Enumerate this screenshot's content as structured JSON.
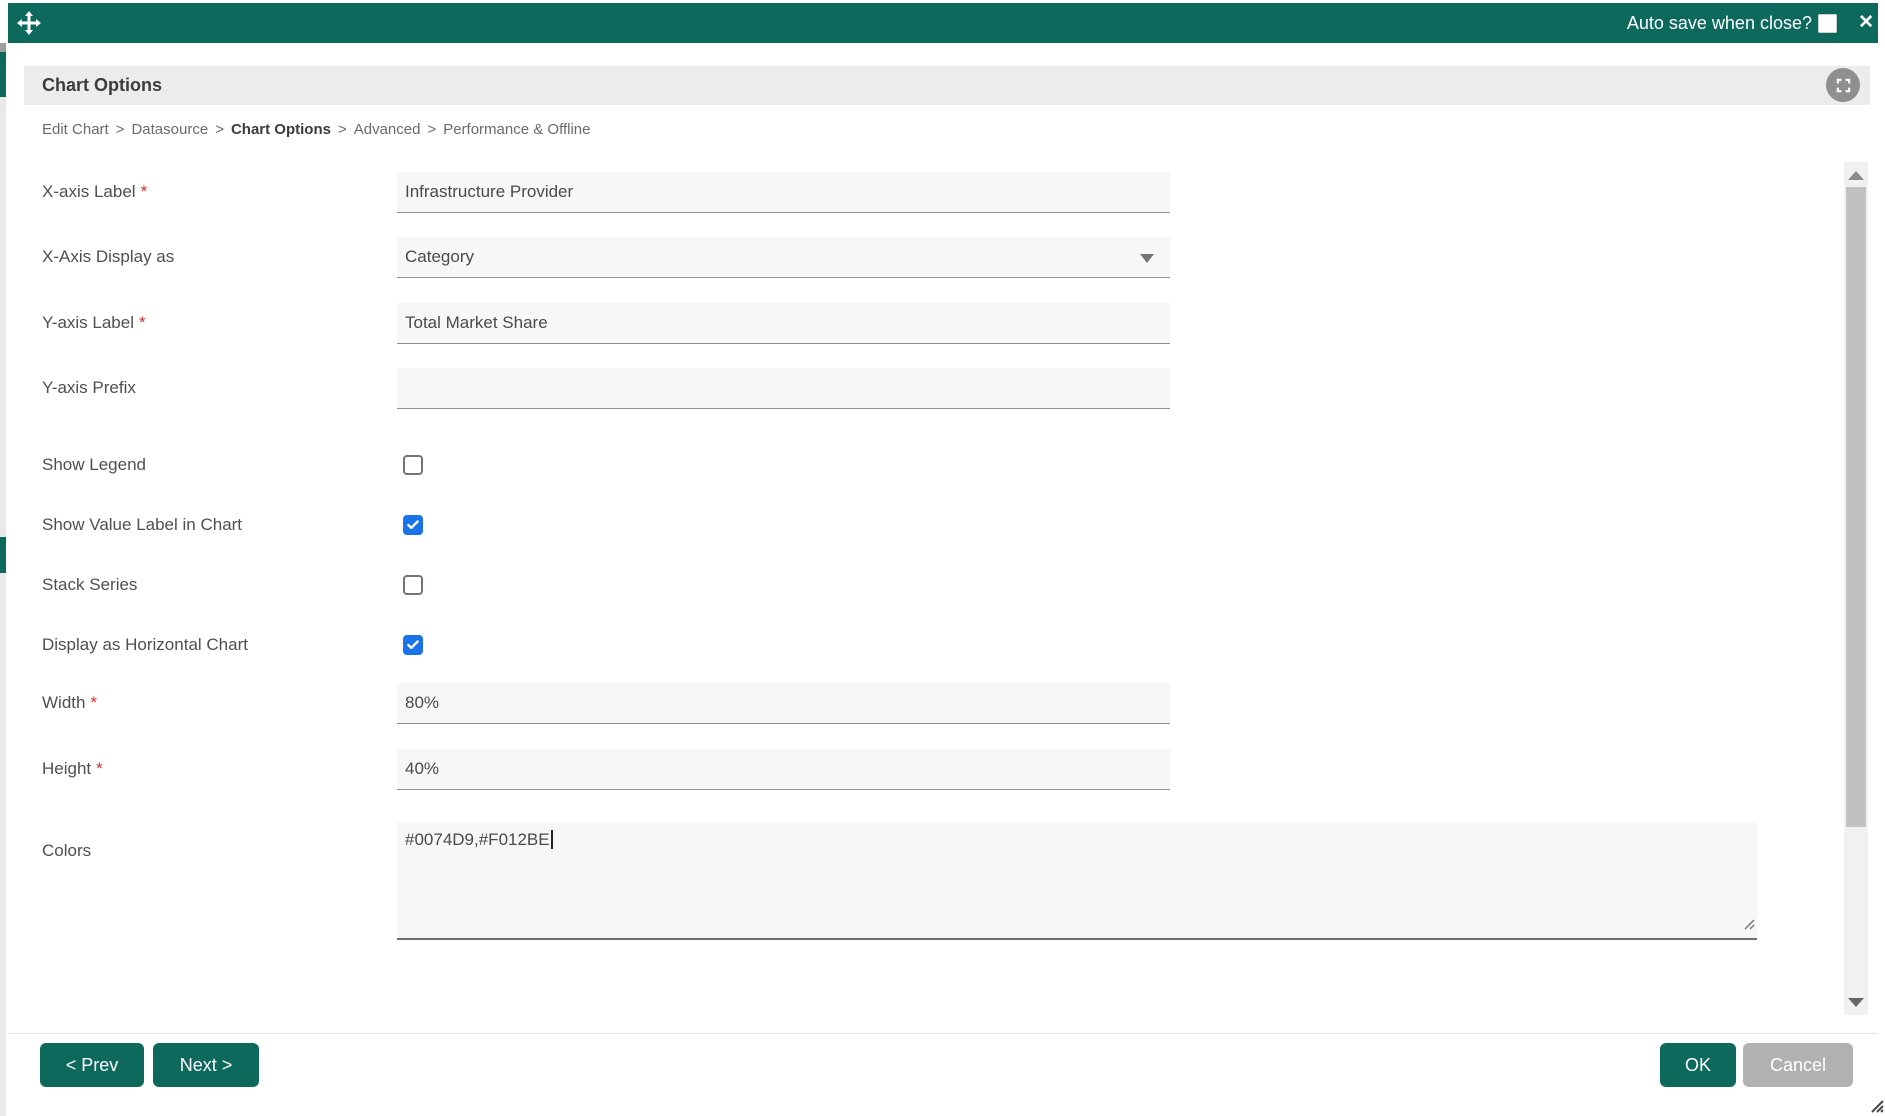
{
  "titlebar": {
    "autosave_label": "Auto save when close?",
    "close_glyph": "✕"
  },
  "header": {
    "title": "Chart Options"
  },
  "breadcrumb": {
    "separator": ">",
    "items": [
      "Edit Chart",
      "Datasource",
      "Chart Options",
      "Advanced",
      "Performance & Offline"
    ],
    "active_item": "Chart Options"
  },
  "form": {
    "required_marker": "*",
    "rows": [
      {
        "label": "X-axis Label",
        "required": true,
        "type": "text",
        "value": "Infrastructure Provider"
      },
      {
        "label": "X-Axis Display as",
        "required": false,
        "type": "select",
        "value": "Category"
      },
      {
        "label": "Y-axis Label",
        "required": true,
        "type": "text",
        "value": "Total Market Share"
      },
      {
        "label": "Y-axis Prefix",
        "required": false,
        "type": "text",
        "value": ""
      },
      {
        "label": "Show Legend",
        "required": false,
        "type": "checkbox",
        "checked": false
      },
      {
        "label": "Show Value Label in Chart",
        "required": false,
        "type": "checkbox",
        "checked": true
      },
      {
        "label": "Stack Series",
        "required": false,
        "type": "checkbox",
        "checked": false
      },
      {
        "label": "Display as Horizontal Chart",
        "required": false,
        "type": "checkbox",
        "checked": true
      },
      {
        "label": "Width",
        "required": true,
        "type": "text",
        "value": "80%"
      },
      {
        "label": "Height",
        "required": true,
        "type": "text",
        "value": "40%"
      },
      {
        "label": "Colors",
        "required": false,
        "type": "textarea",
        "value": "#0074D9,#F012BE"
      }
    ]
  },
  "footer": {
    "prev_label": "< Prev",
    "next_label": "Next >",
    "ok_label": "OK",
    "cancel_label": "Cancel"
  },
  "colors": {
    "accent_teal": "#0D695C",
    "checkbox_checked_blue": "#1A73E8",
    "header_bar_gray": "#ECECEC",
    "field_background": "#F7F7F7"
  }
}
